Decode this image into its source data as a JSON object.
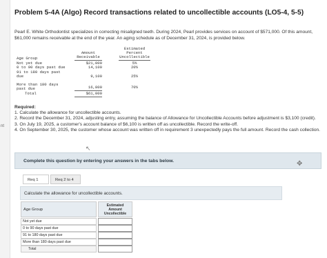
{
  "title": "Problem 5-4A (Algo) Record transactions related to uncollectible accounts (LO5-4, 5-5)",
  "side_label": "nt",
  "intro": "Pearl E. White Orthodontist specializes in correcting misaligned teeth. During 2024, Pearl provides services on account of $571,000. Of this amount, $61,000 remains receivable at the end of the year. An aging schedule as of December 31, 2024, is provided below.",
  "aging": {
    "headers": {
      "group": "Age Group",
      "amount": "Amount\nReceivable",
      "percent": "Estimated\nPercent\nUncollectible"
    },
    "rows": [
      {
        "label": "Not yet due",
        "amount": "$21,000",
        "percent": "5%"
      },
      {
        "label": "0 to 90 days past due",
        "amount": "14,100",
        "percent": "20%"
      },
      {
        "label": "91 to 180 days past\ndue",
        "amount": "9,100",
        "percent": "25%"
      },
      {
        "label": "More than 180 days\npast due",
        "amount": "16,800",
        "percent": "70%"
      },
      {
        "label": "Total",
        "amount": "$61,000",
        "percent": ""
      }
    ]
  },
  "required": {
    "heading": "Required:",
    "items": [
      "1. Calculate the allowance for uncollectible accounts.",
      "2. Record the December 31, 2024, adjusting entry, assuming the balance of Allowance for Uncollectible Accounts before adjustment is $3,100 (credit).",
      "3. On July 19, 2025, a customer's account balance of $6,100 is written off as uncollectible. Record the write-off.",
      "4. On September 30, 2025, the customer whose account was written off in requirement 3 unexpectedly pays the full amount. Record the cash collection."
    ]
  },
  "complete_text": "Complete this question by entering your answers in the tabs below.",
  "tabs": [
    {
      "label": "Req 1"
    },
    {
      "label": "Req 2 to 4"
    }
  ],
  "calc_text": "Calculate the allowance for uncollectible accounts.",
  "answer_table": {
    "col1": "Age Group",
    "col2": "Estimated\nAmount\nUncollectible",
    "rows": [
      "Not yet due",
      "0 to 90 days past due",
      "91 to 180 days past due",
      "More than 180 days past due",
      "Total"
    ]
  }
}
